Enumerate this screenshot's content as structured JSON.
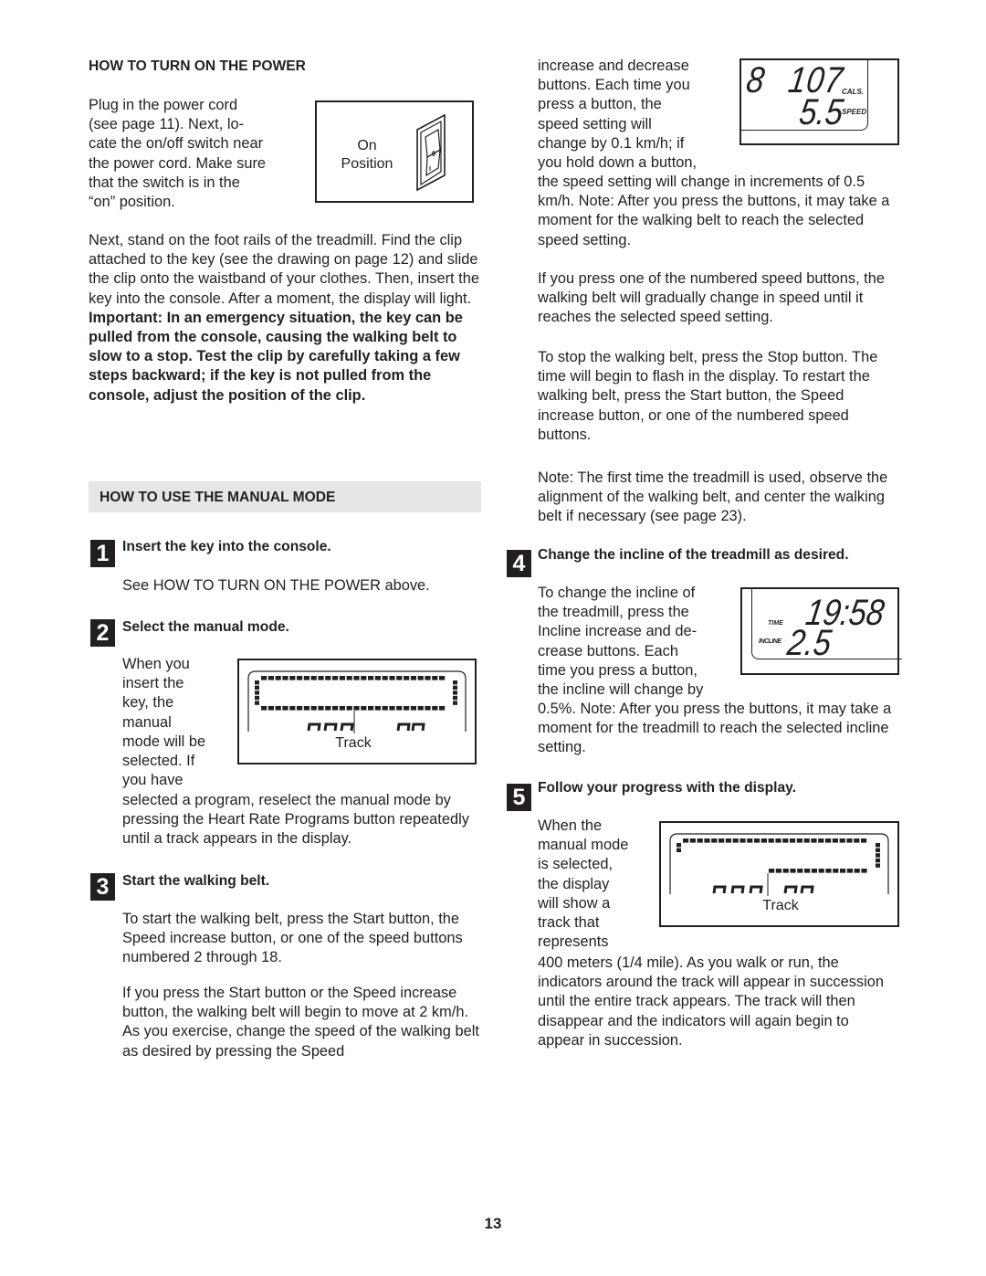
{
  "page_number": "13",
  "power": {
    "heading": "HOW TO TURN ON THE POWER",
    "intro_lines": [
      "Plug in the power cord",
      "(see page 11). Next, lo-",
      "cate the on/off switch near",
      "the power cord. Make sure",
      "that the switch is in the",
      "“on” position."
    ],
    "figure_label_line1": "On",
    "figure_label_line2": "Position",
    "para2_normal": "Next, stand on the foot rails of the treadmill. Find the clip attached to the key (see the drawing on page 12) and slide the clip onto the waistband of your clothes. Then, insert the key into the console. After a moment, the display will light. ",
    "para2_bold": "Important: In an emergency situation, the key can be pulled from the console, causing the walking belt to slow to a stop. Test the clip by carefully taking a few steps backward; if the key is not pulled from the console, adjust the position of the clip."
  },
  "manual_mode": {
    "heading": "HOW TO USE THE MANUAL MODE",
    "steps": [
      {
        "number": "1",
        "title": "Insert the key into the console.",
        "body": "See HOW TO TURN ON THE POWER above."
      },
      {
        "number": "2",
        "title": "Select the manual mode.",
        "wrap_lines": [
          "When you",
          "insert the",
          "key, the",
          "manual",
          "mode will be",
          "selected. If",
          "you have"
        ],
        "body_rest": "selected a program, reselect the manual mode by pressing the Heart Rate Programs button repeatedly until a track appears in the display.",
        "figure_label": "Track"
      },
      {
        "number": "3",
        "title": "Start the walking belt.",
        "para1": "To start the walking belt, press the Start button, the Speed increase button, or one of the speed buttons numbered 2 through 18.",
        "para2": "If you press the Start button or the Speed increase button, the walking belt will begin to move at 2 km/h. As you exercise, change the speed of the walking belt as desired by pressing the Speed"
      },
      {
        "number": "4",
        "title": "Change the incline of the treadmill as desired.",
        "wrap_lines": [
          "To change the incline of",
          "the treadmill, press the",
          "Incline increase and de-",
          "crease buttons. Each",
          "time you press a button,",
          "the incline will change by"
        ],
        "body_rest": "0.5%. Note: After you press the buttons, it may take a moment for the treadmill to reach the selected incline setting.",
        "display": {
          "time_label": "TIME",
          "time_value": "19:58",
          "incline_label": "INCLINE",
          "incline_value": "2.5"
        }
      },
      {
        "number": "5",
        "title": "Follow your progress with the display.",
        "wrap_lines": [
          "When the",
          "manual mode",
          "is selected,",
          "the display",
          "will show a",
          "track that",
          "represents"
        ],
        "body_rest": "400 meters (1/4 mile). As you walk or run, the indicators around the track will appear in succession until the entire track appears. The track will then disappear and the indicators will again begin to appear in succession.",
        "figure_label": "Track"
      }
    ],
    "speed_continued": {
      "wrap_lines": [
        "increase and decrease",
        "buttons. Each time you",
        "press a button, the",
        "speed setting will",
        "change by 0.1 km/h; if",
        "you hold down a button,"
      ],
      "body_rest": "the speed setting will change in increments of 0.5 km/h. Note: After you press the buttons, it may take a moment for the walking belt to reach the selected speed setting.",
      "display": {
        "left_digit": "8",
        "cals_value": "107",
        "cals_label": "CALS.",
        "speed_value": "5.5",
        "speed_label": "SPEED"
      },
      "para_numbered": "If you press one of the numbered speed buttons, the walking belt will gradually change in speed until it reaches the selected speed setting.",
      "para_stop": "To stop the walking belt, press the Stop button. The time will begin to flash in the display. To restart the walking belt, press the Start button, the Speed increase button, or one of the numbered speed buttons.",
      "para_note": "Note: The first time the treadmill is used, observe the alignment of the walking belt, and center the walking belt if necessary (see page 23)."
    }
  }
}
